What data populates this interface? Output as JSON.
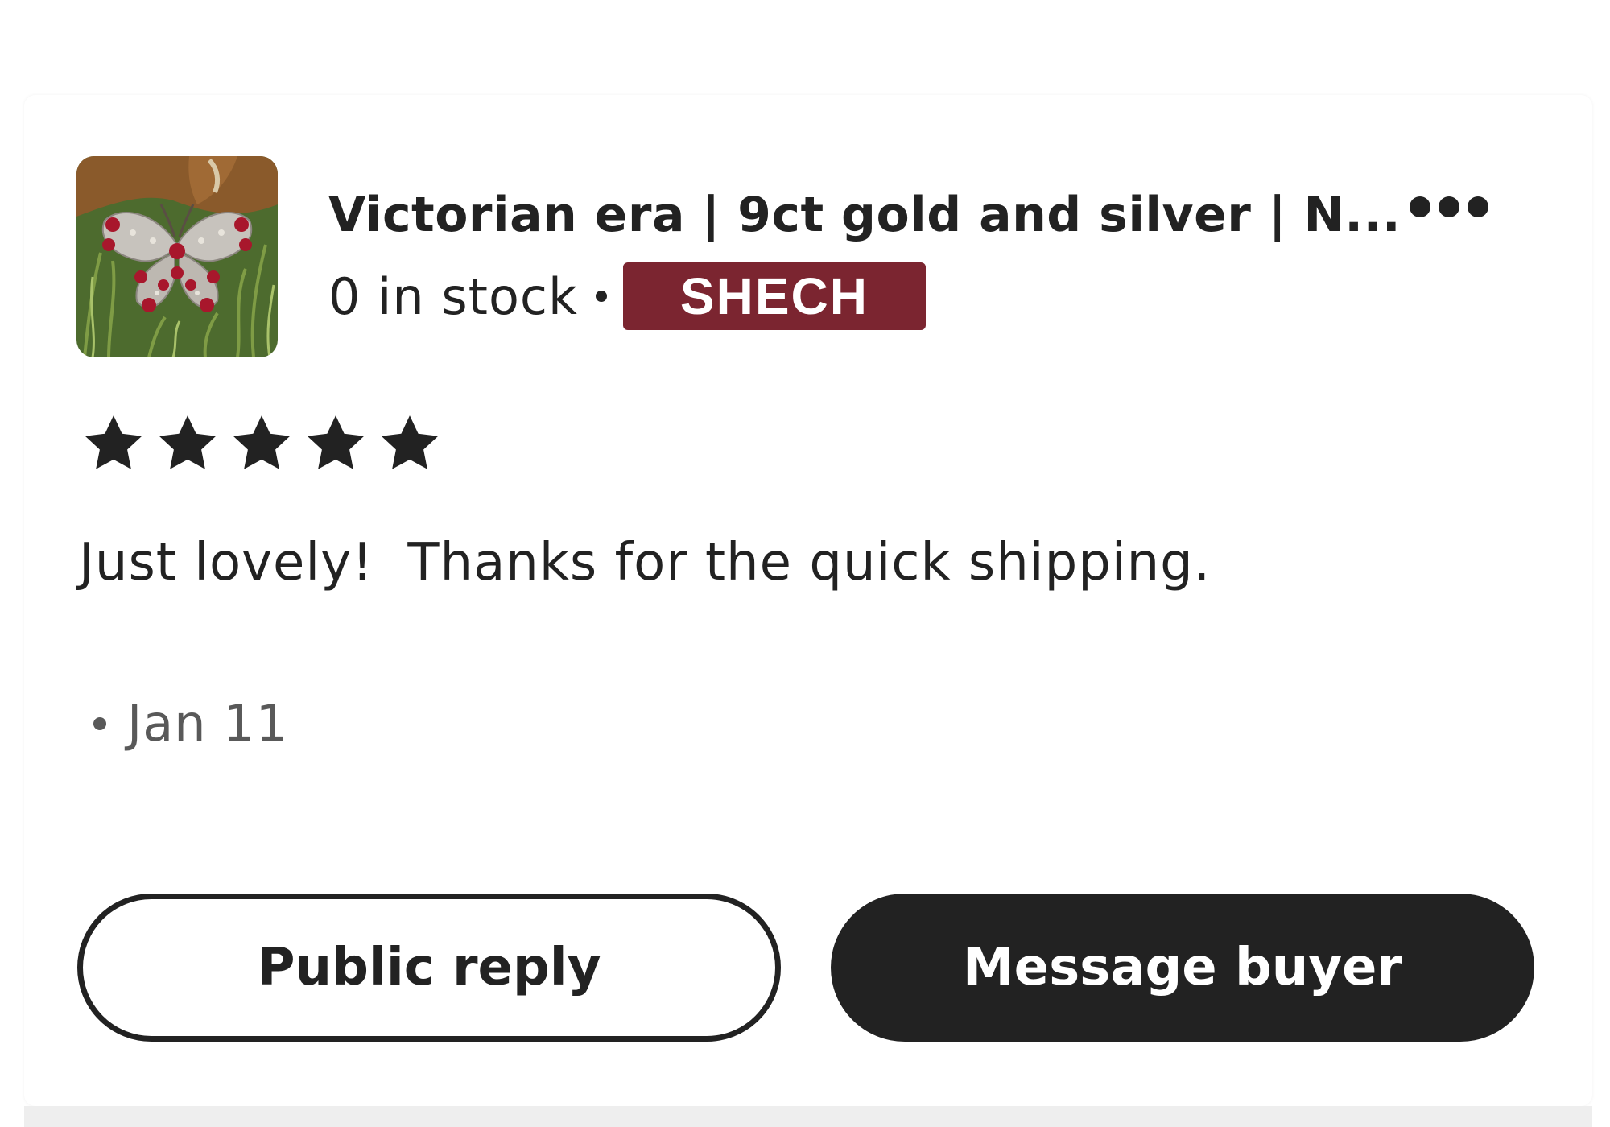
{
  "review": {
    "listing_title": "Victorian era | 9ct gold and silver | N...",
    "stock_text": "0 in stock",
    "shop_badge": "SHECH",
    "rating": 5,
    "rating_max": 5,
    "text": "Just lovely!  Thanks for the quick shipping.",
    "date": "Jan 11",
    "more_icon": "more-horizontal-icon",
    "thumbnail_icon": "butterfly-brooch-thumbnail"
  },
  "actions": {
    "public_reply_label": "Public reply",
    "message_buyer_label": "Message buyer"
  },
  "colors": {
    "text": "#222222",
    "muted": "#595959",
    "badge": "#7b2530",
    "button_dark": "#222222"
  }
}
